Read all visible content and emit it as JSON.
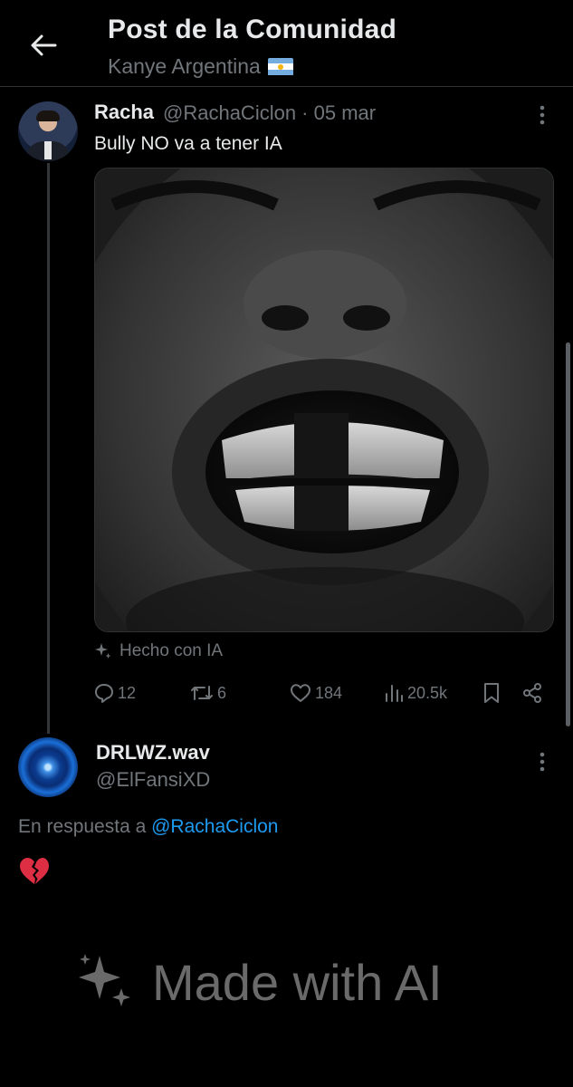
{
  "header": {
    "title": "Post de la Comunidad",
    "community": "Kanye Argentina"
  },
  "post": {
    "author_name": "Racha",
    "author_handle": "@RachaCiclon · 05 mar",
    "text": "Bully NO va a tener IA",
    "ai_label": "Hecho con IA",
    "stats": {
      "replies": "12",
      "reposts": "6",
      "likes": "184",
      "views": "20.5k"
    }
  },
  "reply": {
    "author_name": "DRLWZ.wav",
    "author_handle": "@ElFansiXD",
    "reply_prefix": "En respuesta a",
    "reply_mention": "@RachaCiclon"
  },
  "watermark": {
    "text": "Made with AI"
  },
  "colors": {
    "background": "#000000",
    "text_primary": "#e7e9ea",
    "text_secondary": "#71767b",
    "link": "#1d9bf0",
    "divider": "#2f3336"
  },
  "icons": [
    "back-arrow-icon",
    "flag-argentina-icon",
    "more-vertical-icon",
    "sparkle-icon",
    "reply-icon",
    "repost-icon",
    "like-icon",
    "views-icon",
    "bookmark-icon",
    "share-icon",
    "broken-heart-icon"
  ]
}
